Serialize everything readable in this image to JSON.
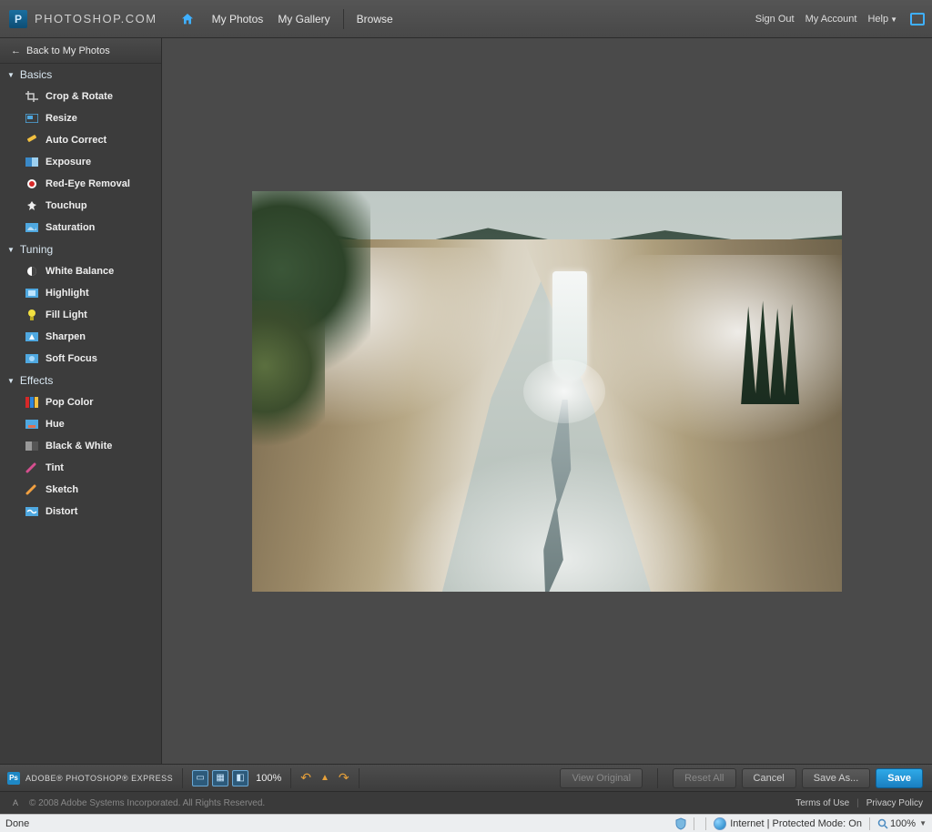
{
  "nav": {
    "site_title": "PHOTOSHOP.COM",
    "my_photos": "My Photos",
    "my_gallery": "My Gallery",
    "browse": "Browse",
    "sign_out": "Sign Out",
    "my_account": "My Account",
    "help": "Help"
  },
  "sidebar": {
    "back": "Back to My Photos",
    "sections": {
      "basics": {
        "label": "Basics",
        "items": [
          "Crop & Rotate",
          "Resize",
          "Auto Correct",
          "Exposure",
          "Red-Eye Removal",
          "Touchup",
          "Saturation"
        ]
      },
      "tuning": {
        "label": "Tuning",
        "items": [
          "White Balance",
          "Highlight",
          "Fill Light",
          "Sharpen",
          "Soft Focus"
        ]
      },
      "effects": {
        "label": "Effects",
        "items": [
          "Pop Color",
          "Hue",
          "Black & White",
          "Tint",
          "Sketch",
          "Distort"
        ]
      }
    }
  },
  "bottombar": {
    "app_name": "ADOBE® PHOTOSHOP® EXPRESS",
    "zoom_pct": "100%",
    "view_original": "View Original",
    "reset_all": "Reset All",
    "cancel": "Cancel",
    "save_as": "Save As...",
    "save": "Save"
  },
  "footer": {
    "copyright": "© 2008 Adobe Systems Incorporated. All Rights Reserved.",
    "terms": "Terms of Use",
    "privacy": "Privacy Policy"
  },
  "ie": {
    "done": "Done",
    "zone": "Internet | Protected Mode: On",
    "zoom": "100%"
  }
}
